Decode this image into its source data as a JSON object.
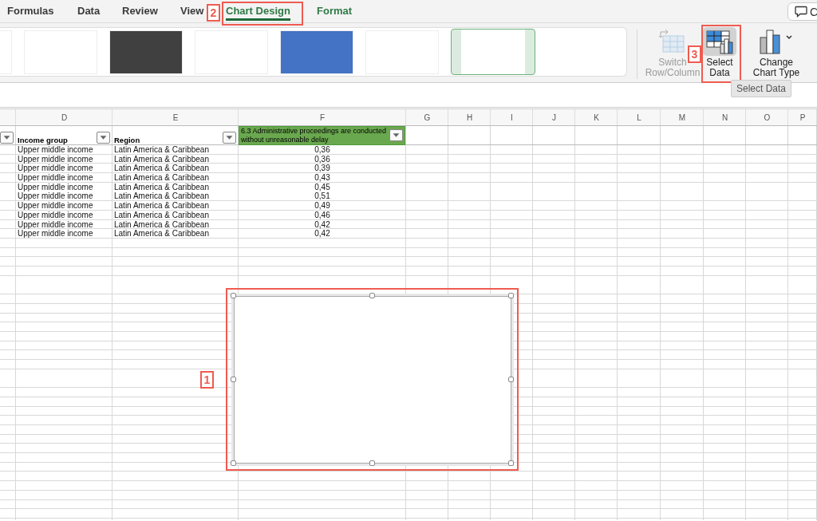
{
  "menu_tabs": [
    {
      "label": "Formulas",
      "kind": "standard",
      "selected": false
    },
    {
      "label": "Data",
      "kind": "standard",
      "selected": false
    },
    {
      "label": "Review",
      "kind": "standard",
      "selected": false
    },
    {
      "label": "View",
      "kind": "standard",
      "selected": false
    },
    {
      "label": "Chart Design",
      "kind": "contextual",
      "selected": true
    },
    {
      "label": "Format",
      "kind": "contextual",
      "selected": false
    }
  ],
  "comment_button": {
    "label": "C"
  },
  "chart_styles": [
    {
      "kind": "light",
      "selected": false
    },
    {
      "kind": "light",
      "selected": false
    },
    {
      "kind": "dark",
      "selected": false
    },
    {
      "kind": "light",
      "selected": false
    },
    {
      "kind": "blue",
      "selected": false
    },
    {
      "kind": "light",
      "selected": false
    },
    {
      "kind": "light",
      "selected": true
    }
  ],
  "ribbon_buttons": [
    {
      "kind": "switch",
      "lines": [
        "Switch",
        "Row/Column"
      ],
      "disabled": true,
      "selected": false
    },
    {
      "kind": "select",
      "lines": [
        "Select",
        "Data"
      ],
      "disabled": false,
      "selected": true
    },
    {
      "kind": "change",
      "lines": [
        "Change",
        "Chart Type"
      ],
      "disabled": false,
      "selected": false
    }
  ],
  "tooltip": "Select Data",
  "sheet": {
    "columns": [
      "",
      "D",
      "E",
      "F",
      "G",
      "H",
      "I",
      "J",
      "K",
      "L",
      "M",
      "N",
      "O",
      "P"
    ],
    "header": [
      {
        "filter": true,
        "highlighted": false
      },
      {
        "text": "Income group",
        "filter": true,
        "highlighted": false
      },
      {
        "text": "Region",
        "filter": true,
        "highlighted": false
      },
      {
        "text": "6.3 Administrative proceedings are conducted without unreasonable delay",
        "filter": true,
        "highlighted": true
      }
    ],
    "rows": [
      [
        "",
        "Upper middle income",
        "Latin America & Caribbean",
        "0,36"
      ],
      [
        "",
        "Upper middle income",
        "Latin America & Caribbean",
        "0,36"
      ],
      [
        "",
        "Upper middle income",
        "Latin America & Caribbean",
        "0,39"
      ],
      [
        "",
        "Upper middle income",
        "Latin America & Caribbean",
        "0,43"
      ],
      [
        "",
        "Upper middle income",
        "Latin America & Caribbean",
        "0,45"
      ],
      [
        "",
        "Upper middle income",
        "Latin America & Caribbean",
        "0,51"
      ],
      [
        "",
        "Upper middle income",
        "Latin America & Caribbean",
        "0,49"
      ],
      [
        "",
        "Upper middle income",
        "Latin America & Caribbean",
        "0,46"
      ],
      [
        "",
        "Upper middle income",
        "Latin America & Caribbean",
        "0,42"
      ],
      [
        "",
        "Upper middle income",
        "Latin America & Caribbean",
        "0,42"
      ]
    ]
  },
  "chart": {
    "selected": true
  },
  "annotations": [
    {
      "label": "1"
    },
    {
      "label": "2"
    },
    {
      "label": "3"
    }
  ]
}
